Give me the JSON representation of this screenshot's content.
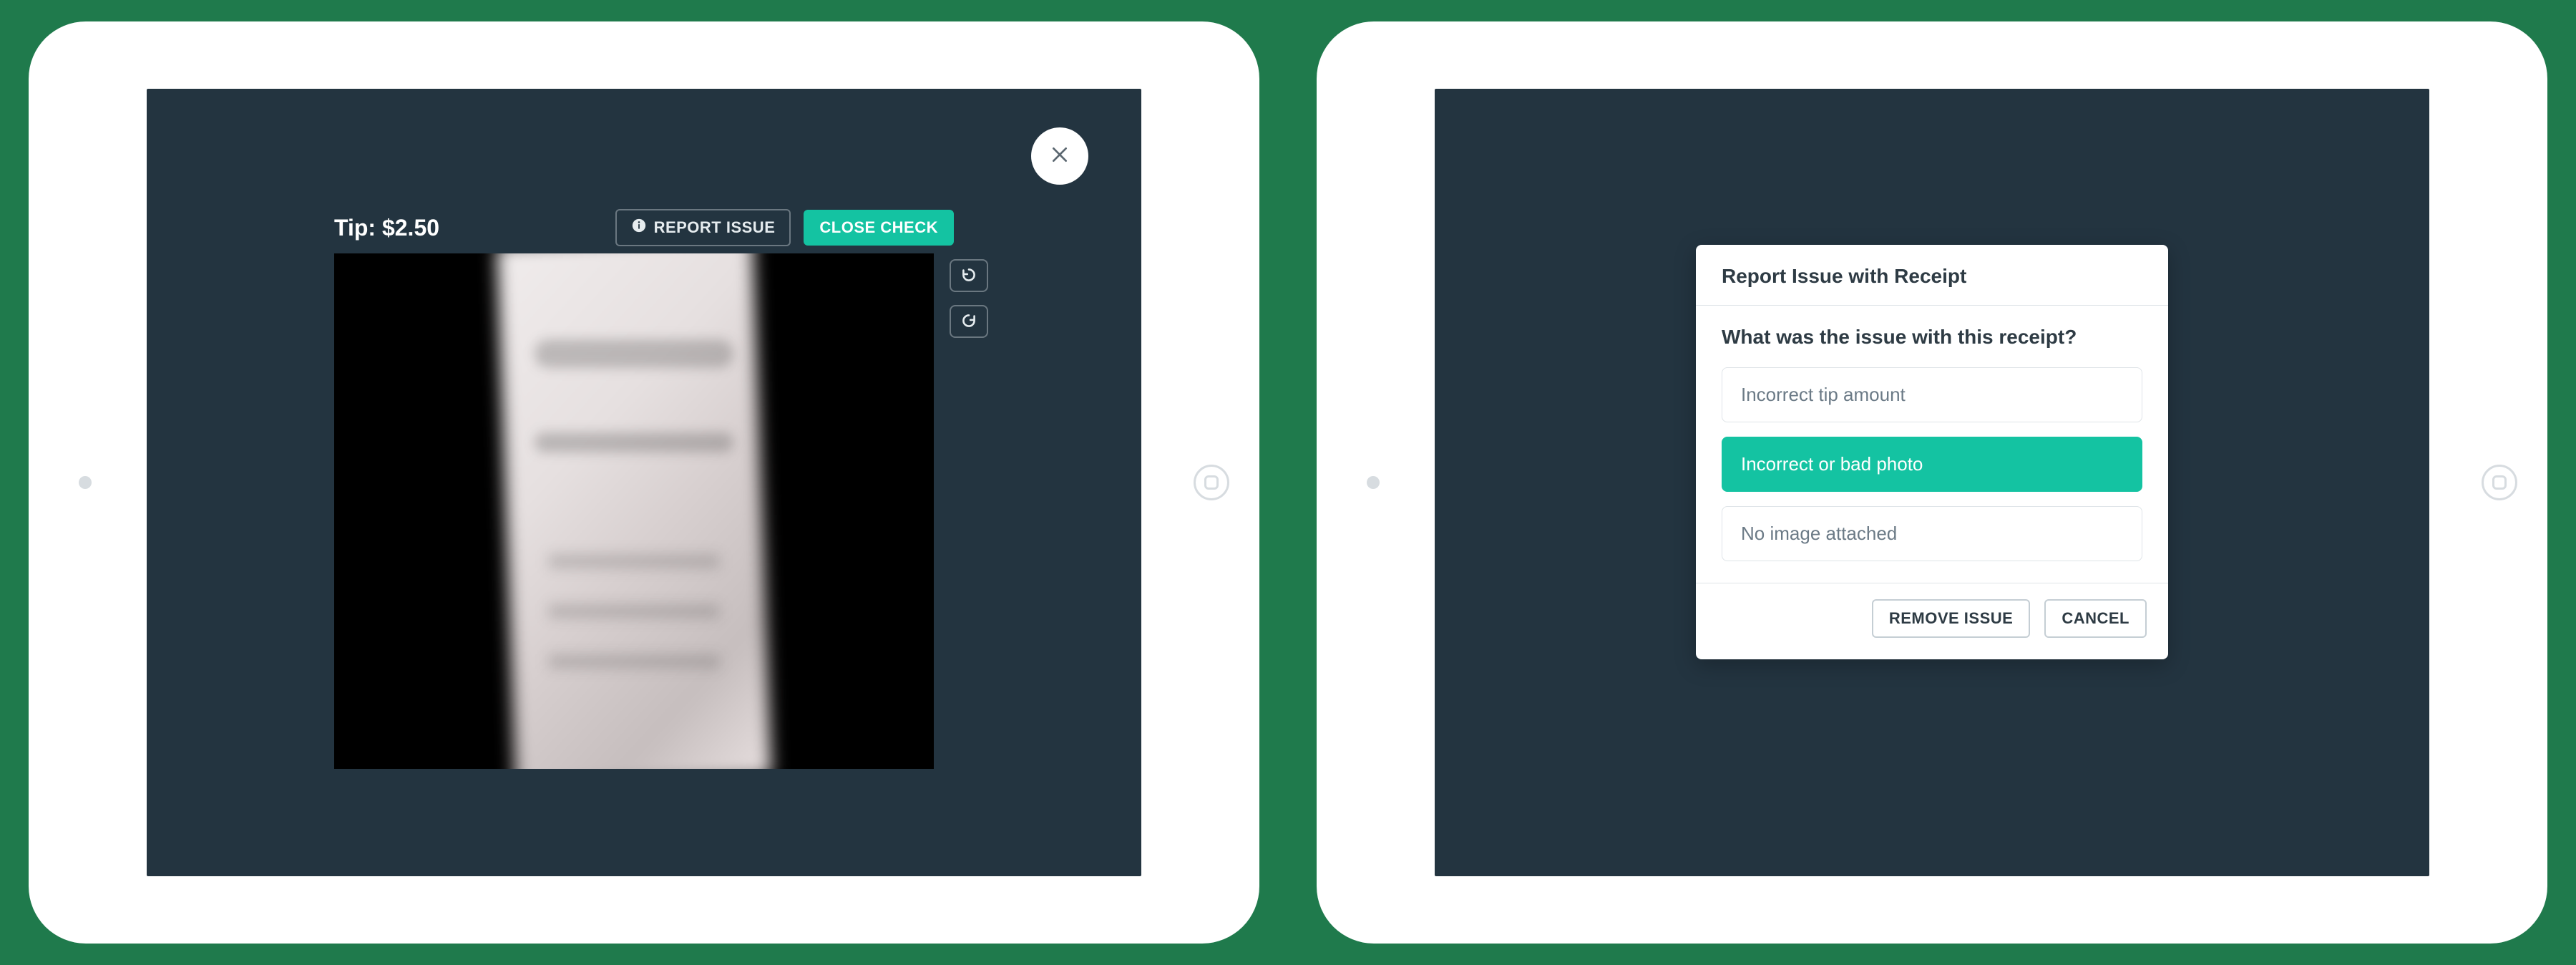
{
  "left": {
    "tip_label": "Tip: $2.50",
    "report_issue_label": "REPORT ISSUE",
    "close_check_label": "CLOSE CHECK"
  },
  "right": {
    "modal_title": "Report Issue with Receipt",
    "question": "What was the issue with this receipt?",
    "options": [
      {
        "label": "Incorrect tip amount",
        "selected": false
      },
      {
        "label": "Incorrect or bad photo",
        "selected": true
      },
      {
        "label": "No image attached",
        "selected": false
      }
    ],
    "remove_issue_label": "REMOVE ISSUE",
    "cancel_label": "CANCEL"
  }
}
